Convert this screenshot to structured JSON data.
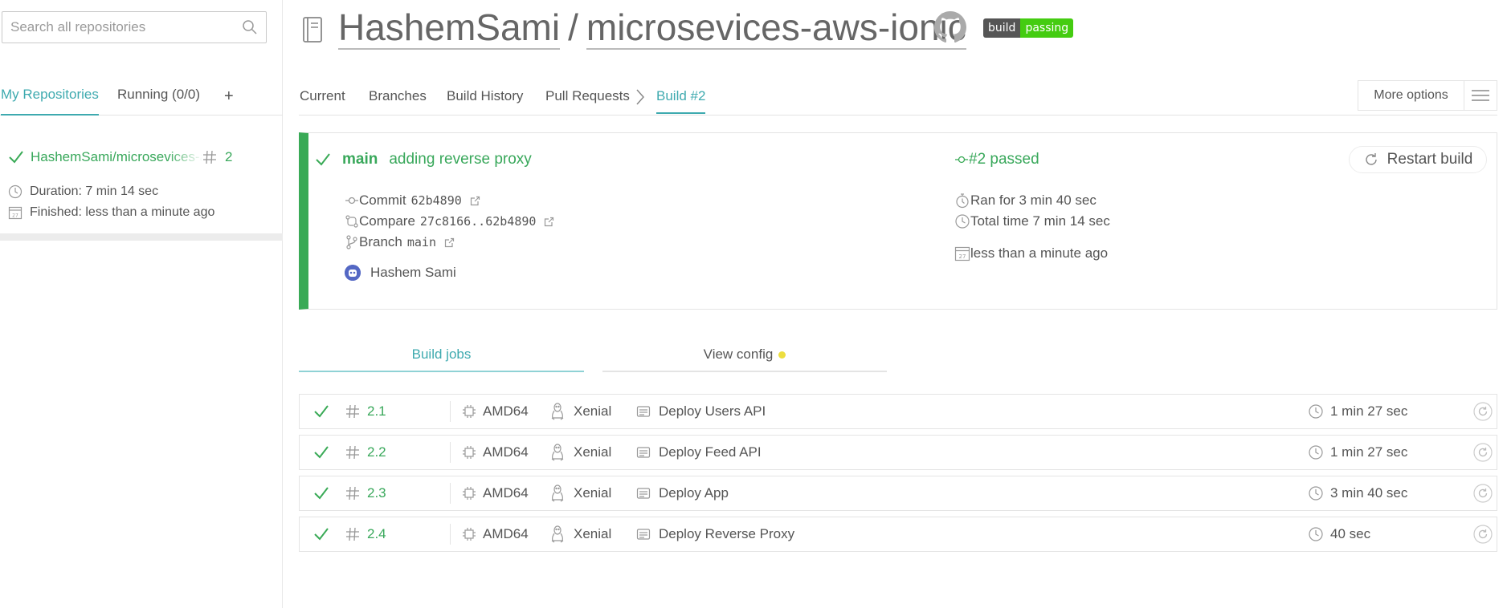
{
  "sidebar": {
    "search_placeholder": "Search all repositories",
    "tabs": {
      "my_repositories": "My Repositories",
      "running": "Running (0/0)",
      "add": "+"
    },
    "repo": {
      "name": "HashemSami/microsevices-aws-ionic",
      "build_number": "2",
      "duration": "Duration: 7 min 14 sec",
      "finished": "Finished: less than a minute ago"
    }
  },
  "header": {
    "owner": "HashemSami",
    "separator": "/",
    "repo": "microsevices-aws-ionic",
    "badge_left": "build",
    "badge_right": "passing"
  },
  "nav": {
    "tabs": [
      "Current",
      "Branches",
      "Build History",
      "Pull Requests"
    ],
    "active_tab": "Build #2",
    "more_options": "More options"
  },
  "build": {
    "branch": "main",
    "message": "adding reverse proxy",
    "commit_label": "Commit",
    "commit": "62b4890",
    "compare_label": "Compare",
    "compare": "27c8166..62b4890",
    "branch_label": "Branch",
    "branch_value": "main",
    "author": "Hashem Sami",
    "status": "#2 passed",
    "ran_for": "Ran for 3 min 40 sec",
    "total_time": "Total time 7 min 14 sec",
    "finished": "less than a minute ago",
    "restart": "Restart build"
  },
  "job_tabs": {
    "build_jobs": "Build jobs",
    "view_config": "View config"
  },
  "jobs": [
    {
      "number": "2.1",
      "arch": "AMD64",
      "dist": "Xenial",
      "name": "Deploy Users API",
      "duration": "1 min 27 sec"
    },
    {
      "number": "2.2",
      "arch": "AMD64",
      "dist": "Xenial",
      "name": "Deploy Feed API",
      "duration": "1 min 27 sec"
    },
    {
      "number": "2.3",
      "arch": "AMD64",
      "dist": "Xenial",
      "name": "Deploy App",
      "duration": "3 min 40 sec"
    },
    {
      "number": "2.4",
      "arch": "AMD64",
      "dist": "Xenial",
      "name": "Deploy Reverse Proxy",
      "duration": "40 sec"
    }
  ],
  "colors": {
    "passed": "#39aa56",
    "accent": "#3eaaaf",
    "badge_pass": "#44cc11",
    "config_dot": "#edde3f"
  }
}
